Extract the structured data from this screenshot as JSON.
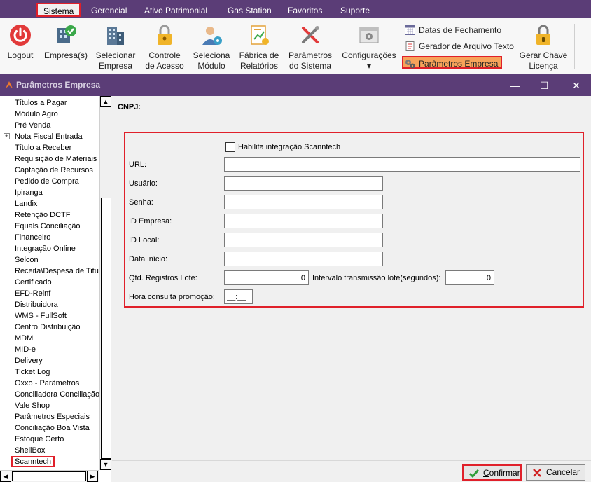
{
  "menu": {
    "items": [
      "Sistema",
      "Gerencial",
      "Ativo Patrimonial",
      "Gas Station",
      "Favoritos",
      "Suporte"
    ]
  },
  "ribbon": {
    "logout": "Logout",
    "empresa": "Empresa(s)",
    "selecionar_empresa_1": "Selecionar",
    "selecionar_empresa_2": "Empresa",
    "controle_1": "Controle",
    "controle_2": "de Acesso",
    "seleciona_1": "Seleciona",
    "seleciona_2": "Módulo",
    "fabrica_1": "Fábrica de",
    "fabrica_2": "Relatórios",
    "parametros_1": "Parâmetros",
    "parametros_2": "do Sistema",
    "configuracoes": "Configurações",
    "configuracoes_arrow": "▾",
    "datas_fechamento": "Datas de Fechamento",
    "gerador_arquivo": "Gerador de Arquivo Texto",
    "parametros_empresa": "Parâmetros Empresa",
    "gerar_chave_1": "Gerar Chave",
    "gerar_chave_2": "Licença"
  },
  "window": {
    "title": "Parâmetros Empresa",
    "minimize": "—",
    "maximize": "☐",
    "close": "✕"
  },
  "tree": {
    "items": [
      {
        "label": "Títulos a Pagar"
      },
      {
        "label": "Módulo Agro"
      },
      {
        "label": "Pré Venda"
      },
      {
        "label": "Nota Fiscal Entrada",
        "expander": "+"
      },
      {
        "label": "Título a Receber"
      },
      {
        "label": "Requisição de Materiais"
      },
      {
        "label": "Captação de Recursos"
      },
      {
        "label": "Pedido de Compra"
      },
      {
        "label": "Ipiranga"
      },
      {
        "label": "Landix"
      },
      {
        "label": "Retenção DCTF"
      },
      {
        "label": "Equals Conciliação"
      },
      {
        "label": "Financeiro"
      },
      {
        "label": "Integração Online"
      },
      {
        "label": "Selcon"
      },
      {
        "label": "Receita\\Despesa de Titulo"
      },
      {
        "label": "Certificado"
      },
      {
        "label": "EFD-Reinf"
      },
      {
        "label": "Distribuidora"
      },
      {
        "label": "WMS - FullSoft"
      },
      {
        "label": "Centro Distribuição"
      },
      {
        "label": "MDM"
      },
      {
        "label": "MID-e"
      },
      {
        "label": "Delivery"
      },
      {
        "label": "Ticket Log"
      },
      {
        "label": "Oxxo - Parâmetros"
      },
      {
        "label": "Conciliadora Conciliação"
      },
      {
        "label": "Vale Shop"
      },
      {
        "label": "Parâmetros Especiais"
      },
      {
        "label": "Conciliação Boa Vista"
      },
      {
        "label": "Estoque Certo"
      },
      {
        "label": "ShellBox"
      },
      {
        "label": "Scanntech",
        "selected": true
      }
    ],
    "scroll_up": "▲",
    "scroll_down": "▼",
    "scroll_left": "◀",
    "scroll_right": "▶"
  },
  "form": {
    "cnpj_label": "CNPJ:",
    "habilita_label": "Habilita integração Scanntech",
    "url_label": "URL:",
    "url_value": "",
    "usuario_label": "Usuário:",
    "usuario_value": "",
    "senha_label": "Senha:",
    "senha_value": "",
    "id_empresa_label": "ID Empresa:",
    "id_empresa_value": "",
    "id_local_label": "ID Local:",
    "id_local_value": "",
    "data_inicio_label": "Data início:",
    "data_inicio_value": "",
    "qtd_registros_label": "Qtd. Registros Lote:",
    "qtd_registros_value": "0",
    "intervalo_label": "Intervalo transmissão lote(segundos):",
    "intervalo_value": "0",
    "hora_consulta_label": "Hora consulta promoção:",
    "hora_consulta_value": "__:__"
  },
  "buttons": {
    "confirm_u": "C",
    "confirm_rest": "onfirmar",
    "cancel_u": "C",
    "cancel_rest": "ancelar"
  },
  "colors": {
    "header_purple": "#5b3d77",
    "highlight_red": "#e0202a",
    "highlight_orange": "#f7a35a"
  }
}
